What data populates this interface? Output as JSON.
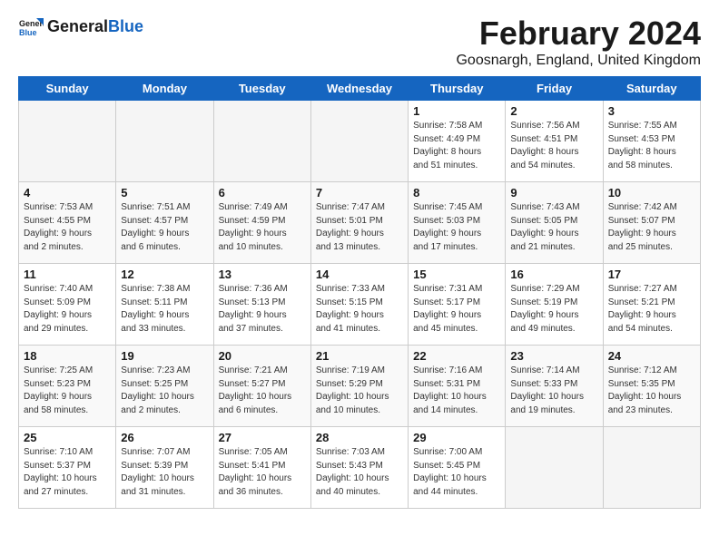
{
  "header": {
    "logo_line1": "General",
    "logo_line2": "Blue",
    "month_title": "February 2024",
    "location": "Goosnargh, England, United Kingdom"
  },
  "days_of_week": [
    "Sunday",
    "Monday",
    "Tuesday",
    "Wednesday",
    "Thursday",
    "Friday",
    "Saturday"
  ],
  "weeks": [
    [
      {
        "day": "",
        "info": ""
      },
      {
        "day": "",
        "info": ""
      },
      {
        "day": "",
        "info": ""
      },
      {
        "day": "",
        "info": ""
      },
      {
        "day": "1",
        "info": "Sunrise: 7:58 AM\nSunset: 4:49 PM\nDaylight: 8 hours\nand 51 minutes."
      },
      {
        "day": "2",
        "info": "Sunrise: 7:56 AM\nSunset: 4:51 PM\nDaylight: 8 hours\nand 54 minutes."
      },
      {
        "day": "3",
        "info": "Sunrise: 7:55 AM\nSunset: 4:53 PM\nDaylight: 8 hours\nand 58 minutes."
      }
    ],
    [
      {
        "day": "4",
        "info": "Sunrise: 7:53 AM\nSunset: 4:55 PM\nDaylight: 9 hours\nand 2 minutes."
      },
      {
        "day": "5",
        "info": "Sunrise: 7:51 AM\nSunset: 4:57 PM\nDaylight: 9 hours\nand 6 minutes."
      },
      {
        "day": "6",
        "info": "Sunrise: 7:49 AM\nSunset: 4:59 PM\nDaylight: 9 hours\nand 10 minutes."
      },
      {
        "day": "7",
        "info": "Sunrise: 7:47 AM\nSunset: 5:01 PM\nDaylight: 9 hours\nand 13 minutes."
      },
      {
        "day": "8",
        "info": "Sunrise: 7:45 AM\nSunset: 5:03 PM\nDaylight: 9 hours\nand 17 minutes."
      },
      {
        "day": "9",
        "info": "Sunrise: 7:43 AM\nSunset: 5:05 PM\nDaylight: 9 hours\nand 21 minutes."
      },
      {
        "day": "10",
        "info": "Sunrise: 7:42 AM\nSunset: 5:07 PM\nDaylight: 9 hours\nand 25 minutes."
      }
    ],
    [
      {
        "day": "11",
        "info": "Sunrise: 7:40 AM\nSunset: 5:09 PM\nDaylight: 9 hours\nand 29 minutes."
      },
      {
        "day": "12",
        "info": "Sunrise: 7:38 AM\nSunset: 5:11 PM\nDaylight: 9 hours\nand 33 minutes."
      },
      {
        "day": "13",
        "info": "Sunrise: 7:36 AM\nSunset: 5:13 PM\nDaylight: 9 hours\nand 37 minutes."
      },
      {
        "day": "14",
        "info": "Sunrise: 7:33 AM\nSunset: 5:15 PM\nDaylight: 9 hours\nand 41 minutes."
      },
      {
        "day": "15",
        "info": "Sunrise: 7:31 AM\nSunset: 5:17 PM\nDaylight: 9 hours\nand 45 minutes."
      },
      {
        "day": "16",
        "info": "Sunrise: 7:29 AM\nSunset: 5:19 PM\nDaylight: 9 hours\nand 49 minutes."
      },
      {
        "day": "17",
        "info": "Sunrise: 7:27 AM\nSunset: 5:21 PM\nDaylight: 9 hours\nand 54 minutes."
      }
    ],
    [
      {
        "day": "18",
        "info": "Sunrise: 7:25 AM\nSunset: 5:23 PM\nDaylight: 9 hours\nand 58 minutes."
      },
      {
        "day": "19",
        "info": "Sunrise: 7:23 AM\nSunset: 5:25 PM\nDaylight: 10 hours\nand 2 minutes."
      },
      {
        "day": "20",
        "info": "Sunrise: 7:21 AM\nSunset: 5:27 PM\nDaylight: 10 hours\nand 6 minutes."
      },
      {
        "day": "21",
        "info": "Sunrise: 7:19 AM\nSunset: 5:29 PM\nDaylight: 10 hours\nand 10 minutes."
      },
      {
        "day": "22",
        "info": "Sunrise: 7:16 AM\nSunset: 5:31 PM\nDaylight: 10 hours\nand 14 minutes."
      },
      {
        "day": "23",
        "info": "Sunrise: 7:14 AM\nSunset: 5:33 PM\nDaylight: 10 hours\nand 19 minutes."
      },
      {
        "day": "24",
        "info": "Sunrise: 7:12 AM\nSunset: 5:35 PM\nDaylight: 10 hours\nand 23 minutes."
      }
    ],
    [
      {
        "day": "25",
        "info": "Sunrise: 7:10 AM\nSunset: 5:37 PM\nDaylight: 10 hours\nand 27 minutes."
      },
      {
        "day": "26",
        "info": "Sunrise: 7:07 AM\nSunset: 5:39 PM\nDaylight: 10 hours\nand 31 minutes."
      },
      {
        "day": "27",
        "info": "Sunrise: 7:05 AM\nSunset: 5:41 PM\nDaylight: 10 hours\nand 36 minutes."
      },
      {
        "day": "28",
        "info": "Sunrise: 7:03 AM\nSunset: 5:43 PM\nDaylight: 10 hours\nand 40 minutes."
      },
      {
        "day": "29",
        "info": "Sunrise: 7:00 AM\nSunset: 5:45 PM\nDaylight: 10 hours\nand 44 minutes."
      },
      {
        "day": "",
        "info": ""
      },
      {
        "day": "",
        "info": ""
      }
    ]
  ]
}
